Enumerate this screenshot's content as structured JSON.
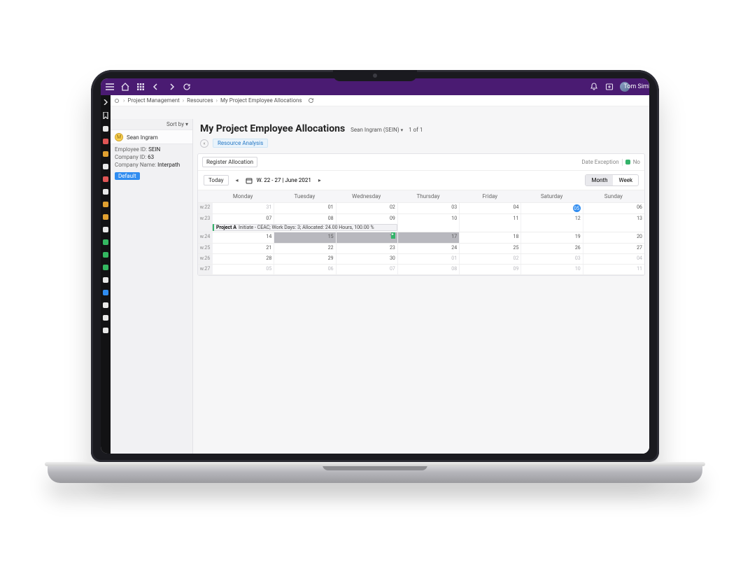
{
  "topbar": {
    "user_name": "Tom Simkin"
  },
  "breadcrumb": {
    "items": [
      "Project Management",
      "Resources",
      "My Project Employee Allocations"
    ]
  },
  "sidebar": {
    "sort_label": "Sort by",
    "user_initials": "M",
    "user_name": "Sean Ingram",
    "employee_id_label": "Employee ID:",
    "employee_id": "SEIN",
    "company_id_label": "Company ID:",
    "company_id": "63",
    "company_name_label": "Company Name:",
    "company_name": "Interpath",
    "default_badge": "Default"
  },
  "page": {
    "title": "My Project Employee Allocations",
    "context_name": "Sean Ingram (SEIN)",
    "pager": "1 of 1"
  },
  "tools": {
    "resource_analysis": "Resource Analysis"
  },
  "panel": {
    "register_btn": "Register Allocation",
    "legend_date_exception": "Date Exception",
    "legend_no": "No"
  },
  "calnav": {
    "today": "Today",
    "range": "W. 22 - 27 | June 2021",
    "month": "Month",
    "week": "Week"
  },
  "calendar": {
    "days": [
      "Monday",
      "Tuesday",
      "Wednesday",
      "Thursday",
      "Friday",
      "Saturday",
      "Sunday"
    ],
    "weeks": [
      {
        "label": "w.22",
        "cells": [
          "31",
          "01",
          "02",
          "03",
          "04",
          "05",
          "06"
        ],
        "todayIndex": 5,
        "muted": [
          0
        ]
      },
      {
        "label": "w.23",
        "cells": [
          "07",
          "08",
          "09",
          "10",
          "11",
          "12",
          "13"
        ],
        "allocation": {
          "title": "Project A",
          "detail": "Initiate - CEAC; Work Days: 3; Allocated: 24.00 Hours, 100.00 %",
          "span": 3
        }
      },
      {
        "label": "w.24",
        "cells": [
          "14",
          "15",
          "16",
          "17",
          "18",
          "19",
          "20"
        ],
        "shadeStart": 1,
        "shadeEnd": 3,
        "flagIndex": 2
      },
      {
        "label": "w.25",
        "cells": [
          "21",
          "22",
          "23",
          "24",
          "25",
          "26",
          "27"
        ]
      },
      {
        "label": "w.26",
        "cells": [
          "28",
          "29",
          "30",
          "01",
          "02",
          "03",
          "04"
        ],
        "muted": [
          3,
          4,
          5,
          6
        ]
      },
      {
        "label": "w.27",
        "cells": [
          "05",
          "06",
          "07",
          "08",
          "09",
          "10",
          "11"
        ],
        "muted": [
          0,
          1,
          2,
          3,
          4,
          5,
          6
        ]
      }
    ]
  }
}
